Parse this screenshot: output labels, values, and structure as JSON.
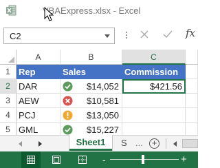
{
  "window": {
    "title": "VBAExpress.xlsx - Excel"
  },
  "formula_bar": {
    "name_box": "C2",
    "fx_label": "fx"
  },
  "grid": {
    "columns": [
      "A",
      "B",
      "C"
    ],
    "rows": [
      "1",
      "2",
      "3",
      "4",
      "5"
    ],
    "header": {
      "rep": "Rep",
      "sales": "Sales",
      "commission": "Commission"
    },
    "data": [
      {
        "rep": "DAR",
        "status": "check",
        "sales": "$14,052",
        "commission": "$421.56"
      },
      {
        "rep": "AEW",
        "status": "cross",
        "sales": "$10,581",
        "commission": ""
      },
      {
        "rep": "PCJ",
        "status": "warning",
        "sales": "$13,050",
        "commission": ""
      },
      {
        "rep": "GML",
        "status": "check",
        "sales": "$15,227",
        "commission": ""
      }
    ],
    "selected_cell": "C2"
  },
  "sheet_tabs": {
    "active": "Sheet1",
    "next_partial": "S",
    "more": "...",
    "add": "+"
  },
  "status_bar": {
    "zoom_minus": "-",
    "zoom_plus": "+"
  },
  "colors": {
    "accent": "#217346",
    "table_header": "#4472c4",
    "ok": "#4e9a4e",
    "bad": "#d9534f",
    "warn": "#f0a830"
  }
}
